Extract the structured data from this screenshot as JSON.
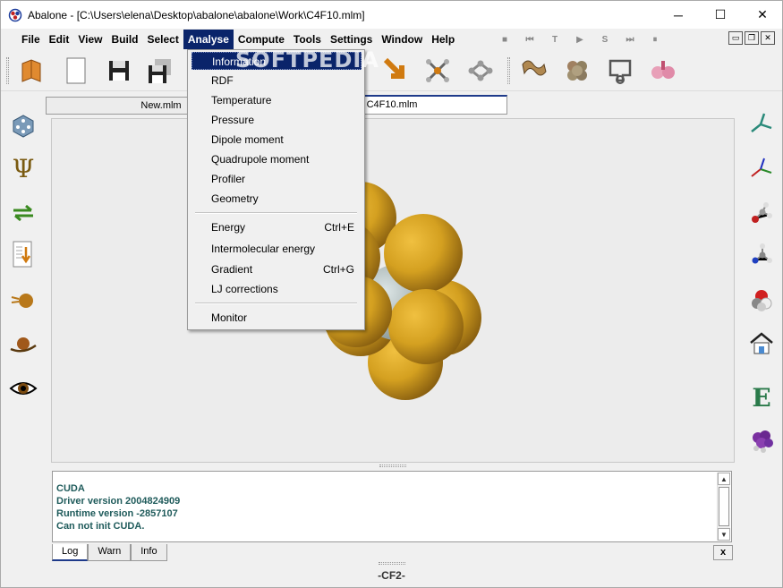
{
  "window": {
    "title": "Abalone - [C:\\Users\\elena\\Desktop\\abalone\\abalone\\Work\\C4F10.mlm]",
    "minimize_glyph": "─",
    "maximize_glyph": "☐",
    "close_glyph": "✕"
  },
  "menubar": {
    "items": [
      "File",
      "Edit",
      "View",
      "Build",
      "Select",
      "Analyse",
      "Compute",
      "Tools",
      "Settings",
      "Window",
      "Help"
    ],
    "active": "Analyse",
    "sim_controls": [
      "■",
      "⏮",
      "T",
      "▶",
      "S",
      "⏭",
      "⏸"
    ],
    "mdi_controls": [
      "▭",
      "❐",
      "✕"
    ]
  },
  "tabs": {
    "items": [
      "New.mlm",
      "C4F10.mlm"
    ],
    "active": "C4F10.mlm"
  },
  "analyse_menu": {
    "items": [
      {
        "label": "Information",
        "shortcut": ""
      },
      {
        "label": "RDF",
        "shortcut": ""
      },
      {
        "label": "Temperature",
        "shortcut": ""
      },
      {
        "label": "Pressure",
        "shortcut": ""
      },
      {
        "label": "Dipole moment",
        "shortcut": ""
      },
      {
        "label": "Quadrupole moment",
        "shortcut": ""
      },
      {
        "label": "Profiler",
        "shortcut": ""
      },
      {
        "label": "Geometry",
        "shortcut": ""
      },
      {
        "label": "Energy",
        "shortcut": "Ctrl+E"
      },
      {
        "label": "Intermolecular energy",
        "shortcut": ""
      },
      {
        "label": "Gradient",
        "shortcut": "Ctrl+G"
      },
      {
        "label": "LJ corrections",
        "shortcut": ""
      },
      {
        "label": "Monitor",
        "shortcut": ""
      }
    ],
    "highlighted": "Information"
  },
  "watermark": "SOFTPEDIA",
  "log": {
    "lines": [
      "CUDA",
      "Driver version 2004824909",
      "Runtime version -2857107",
      "Can not init CUDA."
    ],
    "tabs": [
      "Log",
      "Warn",
      "Info"
    ],
    "active_tab": "Log",
    "close_label": "x"
  },
  "status": {
    "text": "-CF2-"
  },
  "colors": {
    "menu_highlight": "#0a246a",
    "log_text": "#1f5b5b",
    "fluorine": "#d4a020",
    "carbon": "#b8c4c4"
  }
}
